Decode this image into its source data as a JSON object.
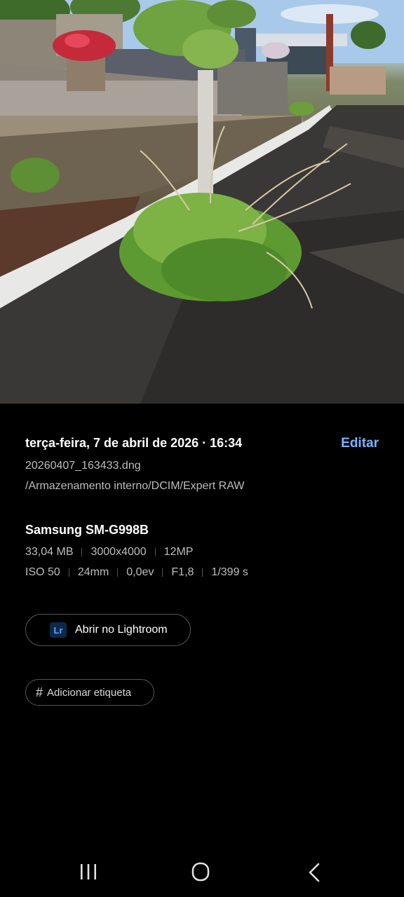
{
  "photo": {
    "alt": ""
  },
  "details": {
    "datetime": "terça-feira, 7 de abril de 2026 · 16:34",
    "edit_label": "Editar",
    "filename": "20260407_163433.dng",
    "path": "/Armazenamento interno/DCIM/Expert RAW"
  },
  "camera": {
    "device": "Samsung SM-G998B",
    "file_info": [
      "33,04 MB",
      "3000x4000",
      "12MP"
    ],
    "exposure_info": [
      "ISO 50",
      "24mm",
      "0,0ev",
      "F1,8",
      "1/399 s"
    ]
  },
  "actions": {
    "lightroom_icon": "Lr",
    "lightroom_label": "Abrir no Lightroom",
    "tag_icon": "#",
    "tag_label": "Adicionar etiqueta"
  },
  "navbar": {
    "icons": [
      "recent-apps-icon",
      "home-icon",
      "back-icon"
    ]
  },
  "colors": {
    "accent": "#7fb0ff",
    "background": "#000000"
  }
}
